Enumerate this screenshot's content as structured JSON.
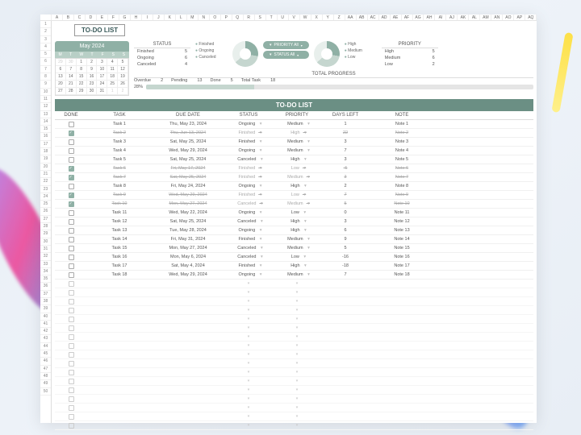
{
  "title": "TO-DO LIST",
  "cols": [
    "",
    "A",
    "B",
    "C",
    "D",
    "E",
    "F",
    "G",
    "H",
    "I",
    "J",
    "K",
    "L",
    "M",
    "N",
    "O",
    "P",
    "Q",
    "R",
    "S",
    "T",
    "U",
    "V",
    "W",
    "X",
    "Y",
    "Z",
    "AA",
    "AB",
    "AC",
    "AD",
    "AE",
    "AF",
    "AG",
    "AH",
    "AI",
    "AJ",
    "AK",
    "AL",
    "AM",
    "AN",
    "AO",
    "AP",
    "AQ"
  ],
  "rowcount": 50,
  "calendar": {
    "month": "May 2024",
    "days": [
      "M",
      "T",
      "W",
      "T",
      "F",
      "S",
      "S"
    ],
    "cells": [
      {
        "v": "29",
        "d": true
      },
      {
        "v": "30",
        "d": true
      },
      {
        "v": "1"
      },
      {
        "v": "2"
      },
      {
        "v": "3"
      },
      {
        "v": "4"
      },
      {
        "v": "5"
      },
      {
        "v": "6"
      },
      {
        "v": "7"
      },
      {
        "v": "8"
      },
      {
        "v": "9"
      },
      {
        "v": "10"
      },
      {
        "v": "11"
      },
      {
        "v": "12"
      },
      {
        "v": "13"
      },
      {
        "v": "14"
      },
      {
        "v": "15"
      },
      {
        "v": "16"
      },
      {
        "v": "17"
      },
      {
        "v": "18"
      },
      {
        "v": "19"
      },
      {
        "v": "20"
      },
      {
        "v": "21"
      },
      {
        "v": "22"
      },
      {
        "v": "23"
      },
      {
        "v": "24"
      },
      {
        "v": "25"
      },
      {
        "v": "26"
      },
      {
        "v": "27"
      },
      {
        "v": "28"
      },
      {
        "v": "29"
      },
      {
        "v": "30"
      },
      {
        "v": "31"
      },
      {
        "v": "1",
        "d": true
      },
      {
        "v": "2",
        "d": true
      }
    ]
  },
  "status": {
    "header": "STATUS",
    "items": [
      {
        "l": "Finished",
        "v": "5"
      },
      {
        "l": "Ongoing",
        "v": "6"
      },
      {
        "l": "Canceled",
        "v": "4"
      }
    ]
  },
  "statusLegend": [
    "Finished",
    "Ongoing",
    "Canceled"
  ],
  "filters": {
    "priority": "PRIORITY   All",
    "status": "STATUS   All"
  },
  "prioLegend": [
    "High",
    "Medium",
    "Low"
  ],
  "priority": {
    "header": "PRIORITY",
    "items": [
      {
        "l": "High",
        "v": "5"
      },
      {
        "l": "Medium",
        "v": "6"
      },
      {
        "l": "Low",
        "v": "2"
      }
    ]
  },
  "progress": {
    "header": "TOTAL PROGRESS",
    "overdue": {
      "l": "Overdue",
      "v": "2"
    },
    "pending": {
      "l": "Pending",
      "v": "13"
    },
    "done": {
      "l": "Done",
      "v": "5"
    },
    "total": {
      "l": "Total Task",
      "v": "18"
    },
    "pct": "28%"
  },
  "table": {
    "title": "TO-DO LIST",
    "headers": [
      "DONE",
      "TASK",
      "DUE DATE",
      "STATUS",
      "PRIORITY",
      "DAYS LEFT",
      "NOTE"
    ],
    "rows": [
      {
        "n": 1,
        "done": false,
        "task": "Task 1",
        "due": "Thu, May 23, 2024",
        "status": "Ongoing",
        "prio": "Medium",
        "days": "1",
        "note": "Note 1"
      },
      {
        "n": 2,
        "done": true,
        "task": "Task 2",
        "due": "Thu, Jun 13, 2024",
        "status": "Finished",
        "prio": "High",
        "days": "22",
        "note": "Note 2",
        "strike": true
      },
      {
        "n": 3,
        "done": false,
        "task": "Task 3",
        "due": "Sat, May 25, 2024",
        "status": "Finished",
        "prio": "Medium",
        "days": "3",
        "note": "Note 3"
      },
      {
        "n": 4,
        "done": false,
        "task": "Task 4",
        "due": "Wed, May 29, 2024",
        "status": "Ongoing",
        "prio": "Medium",
        "days": "7",
        "note": "Note 4"
      },
      {
        "n": 5,
        "done": false,
        "task": "Task 5",
        "due": "Sat, May 25, 2024",
        "status": "Canceled",
        "prio": "High",
        "days": "3",
        "note": "Note 5"
      },
      {
        "n": 6,
        "done": true,
        "task": "Task 6",
        "due": "Fri, May 17, 2024",
        "status": "Finished",
        "prio": "Low",
        "days": "-5",
        "note": "Note 6",
        "strike": true
      },
      {
        "n": 7,
        "done": true,
        "task": "Task 7",
        "due": "Sat, May 25, 2024",
        "status": "Finished",
        "prio": "Medium",
        "days": "3",
        "note": "Note 7",
        "strike": true
      },
      {
        "n": 8,
        "done": false,
        "task": "Task 8",
        "due": "Fri, May 24, 2024",
        "status": "Ongoing",
        "prio": "High",
        "days": "2",
        "note": "Note 8"
      },
      {
        "n": 9,
        "done": true,
        "task": "Task 9",
        "due": "Wed, May 29, 2024",
        "status": "Finished",
        "prio": "Low",
        "days": "7",
        "note": "Note 9",
        "strike": true
      },
      {
        "n": 10,
        "done": true,
        "task": "Task 10",
        "due": "Mon, May 27, 2024",
        "status": "Canceled",
        "prio": "Medium",
        "days": "5",
        "note": "Note 10",
        "strike": true
      },
      {
        "n": 11,
        "done": false,
        "task": "Task 11",
        "due": "Wed, May 22, 2024",
        "status": "Ongoing",
        "prio": "Low",
        "days": "0",
        "note": "Note 11"
      },
      {
        "n": 12,
        "done": false,
        "task": "Task 12",
        "due": "Sat, May 25, 2024",
        "status": "Canceled",
        "prio": "High",
        "days": "3",
        "note": "Note 12"
      },
      {
        "n": 13,
        "done": false,
        "task": "Task 13",
        "due": "Tue, May 28, 2024",
        "status": "Ongoing",
        "prio": "High",
        "days": "6",
        "note": "Note 13"
      },
      {
        "n": 14,
        "done": false,
        "task": "Task 14",
        "due": "Fri, May 31, 2024",
        "status": "Finished",
        "prio": "Medium",
        "days": "9",
        "note": "Note 14"
      },
      {
        "n": 15,
        "done": false,
        "task": "Task 15",
        "due": "Mon, May 27, 2024",
        "status": "Canceled",
        "prio": "Medium",
        "days": "5",
        "note": "Note 15"
      },
      {
        "n": 16,
        "done": false,
        "task": "Task 16",
        "due": "Mon, May 6, 2024",
        "status": "Canceled",
        "prio": "Low",
        "days": "-16",
        "note": "Note 16"
      },
      {
        "n": 17,
        "done": false,
        "task": "Task 17",
        "due": "Sat, May 4, 2024",
        "status": "Finished",
        "prio": "High",
        "days": "-18",
        "note": "Note 17"
      },
      {
        "n": 18,
        "done": false,
        "task": "Task 18",
        "due": "Wed, May 29, 2024",
        "status": "Ongoing",
        "prio": "Medium",
        "days": "7",
        "note": "Note 18"
      }
    ],
    "emptyRows": 17
  }
}
